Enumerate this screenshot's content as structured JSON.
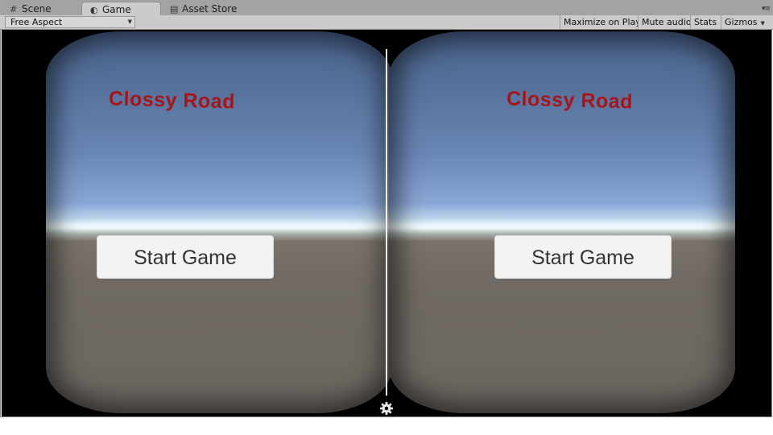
{
  "tabs": [
    {
      "label": "Scene",
      "icon": "grid-icon"
    },
    {
      "label": "Game",
      "icon": "game-controller-icon"
    },
    {
      "label": "Asset Store",
      "icon": "store-icon"
    }
  ],
  "toolbar": {
    "aspect_label": "Free Aspect",
    "maximize_label": "Maximize on Play",
    "mute_label": "Mute audio",
    "stats_label": "Stats",
    "gizmos_label": "Gizmos"
  },
  "game": {
    "left_eye": {
      "title": "Clossy Road",
      "start_label": "Start Game"
    },
    "right_eye": {
      "title": "Clossy Road",
      "start_label": "Start Game"
    },
    "settings_icon": "gear-icon"
  },
  "colors": {
    "title_red": "#a5161b",
    "sky_blue": "#557099",
    "ground": "#716a64",
    "toolbar_bg": "#cbcbcb"
  }
}
